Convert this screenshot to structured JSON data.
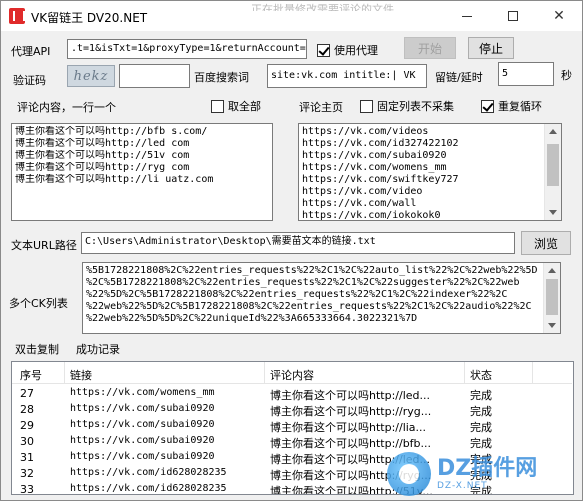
{
  "window": {
    "title": "VK留链王 DV20.NET",
    "bg_title": "正在批量修改需要评论的文件"
  },
  "proxy": {
    "label": "代理API",
    "value": ".t=1&isTxt=1&proxyType=1&returnAccount=1",
    "use_proxy_label": "使用代理",
    "use_proxy_checked": true
  },
  "controls": {
    "start_label": "开始",
    "stop_label": "停止"
  },
  "captcha": {
    "label": "验证码",
    "image_text": "hekz",
    "value": ""
  },
  "baidu": {
    "label": "百度搜索词",
    "value": "site:vk.com intitle:| VK"
  },
  "delay": {
    "label": "留链/延时",
    "value": "5",
    "unit": "秒"
  },
  "comments": {
    "label": "评论内容，一行一个",
    "select_all_label": "取全部",
    "select_all_checked": false,
    "lines": [
      "博主你看这个可以吗http://bfb    s.com/",
      "博主你看这个可以吗http://led     com",
      "博主你看这个可以吗http://51v     com",
      "博主你看这个可以吗http://ryg     com",
      "博主你看这个可以吗http://li      uatz.com"
    ]
  },
  "pages": {
    "label": "评论主页",
    "fixed_list_label": "固定列表不采集",
    "fixed_list_checked": false,
    "repeat_label": "重复循环",
    "repeat_checked": true,
    "lines": [
      "https://vk.com/videos",
      "https://vk.com/id327422102",
      "https://vk.com/subai0920",
      "https://vk.com/womens_mm",
      "https://vk.com/swiftkey727",
      "https://vk.com/video",
      "https://vk.com/wall",
      "https://vk.com/iokokok0"
    ]
  },
  "textpath": {
    "label": "文本URL路径",
    "value": "C:\\Users\\Administrator\\Desktop\\需要苗文本的链接.txt",
    "browse_label": "浏览"
  },
  "ck": {
    "label": "多个CK列表",
    "lines": [
      "%5B1728221808%2C%22entries_requests%22%2C1%2C%22auto_list%22%2C%22web%22%5D",
      "%2C%5B1728221808%2C%22entries_requests%22%2C1%2C%22suggester%22%2C%22web",
      "%22%5D%2C%5B1728221808%2C%22entries_requests%22%2C1%2C%22indexer%22%2C",
      "%22web%22%5D%2C%5B1728221808%2C%22entries_requests%22%2C1%2C%22audio%22%2C",
      "%22web%22%5D%5D%2C%22uniqueId%22%3A665333664.3022321%7D"
    ]
  },
  "record": {
    "double_click_label": "双击复制",
    "success_label": "成功记录"
  },
  "table": {
    "headers": [
      "序号",
      "链接",
      "评论内容",
      "状态"
    ],
    "rows": [
      {
        "n": "27",
        "link": "https://vk.com/womens_mm",
        "content": "博主你看这个可以吗http://led...",
        "status": "完成"
      },
      {
        "n": "28",
        "link": "https://vk.com/subai0920",
        "content": "博主你看这个可以吗http://ryg...",
        "status": "完成"
      },
      {
        "n": "29",
        "link": "https://vk.com/subai0920",
        "content": "博主你看这个可以吗http://lia...",
        "status": "完成"
      },
      {
        "n": "30",
        "link": "https://vk.com/subai0920",
        "content": "博主你看这个可以吗http://bfb...",
        "status": "完成"
      },
      {
        "n": "31",
        "link": "https://vk.com/subai0920",
        "content": "博主你看这个可以吗http://led...",
        "status": "完成"
      },
      {
        "n": "32",
        "link": "https://vk.com/id628028235",
        "content": "博主你看这个可以吗http://ryg...",
        "status": "完成"
      },
      {
        "n": "33",
        "link": "https://vk.com/id628028235",
        "content": "博主你看这个可以吗http://51v...",
        "status": "完成"
      }
    ]
  },
  "watermark": {
    "main": "DZ插件网",
    "sub": "DZ-X.NET"
  }
}
